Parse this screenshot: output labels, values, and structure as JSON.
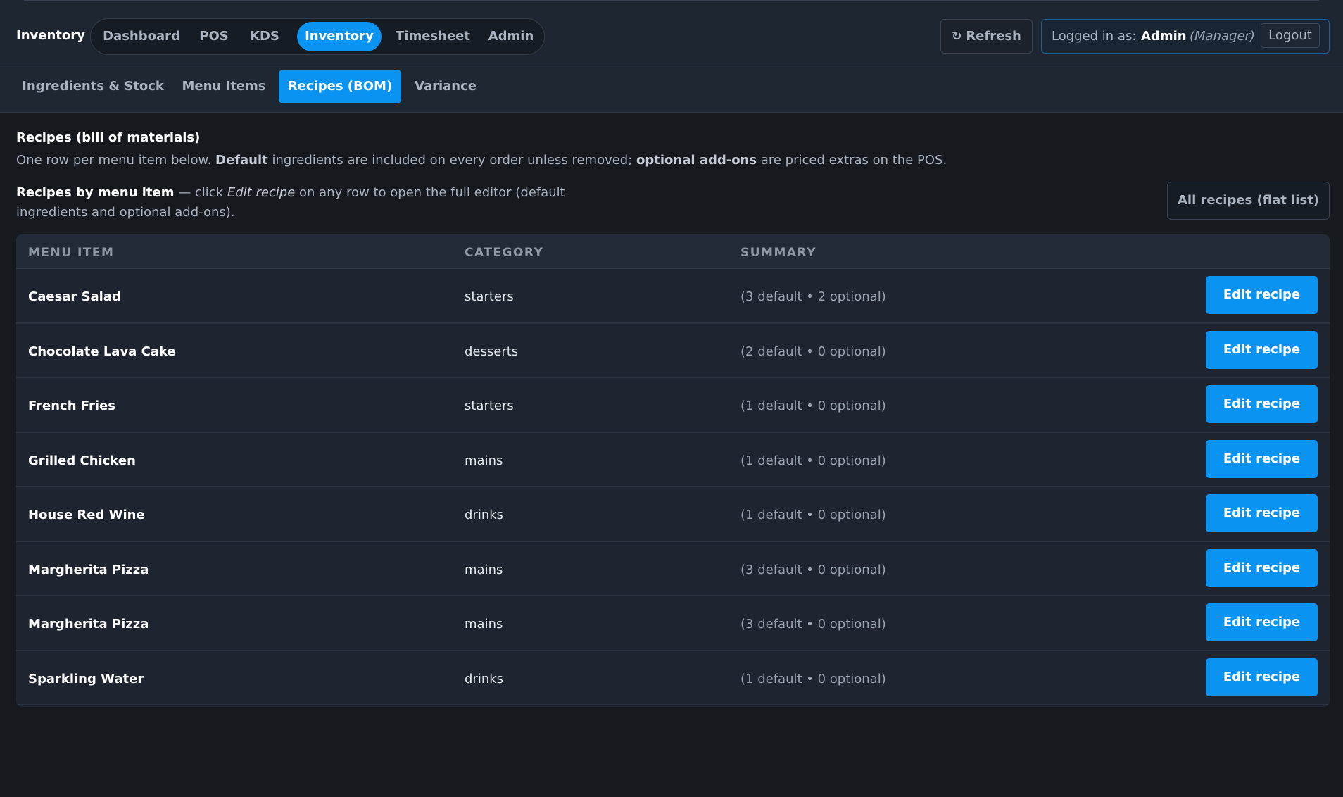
{
  "app": {
    "title": "Inventory"
  },
  "main_nav": {
    "items": [
      {
        "label": "Dashboard",
        "active": false
      },
      {
        "label": "POS",
        "active": false
      },
      {
        "label": "KDS",
        "active": false
      },
      {
        "label": "Inventory",
        "active": true
      },
      {
        "label": "Timesheet",
        "active": false
      },
      {
        "label": "Admin",
        "active": false
      }
    ]
  },
  "toolbar": {
    "refresh_icon": "refresh-icon",
    "refresh_label": "Refresh",
    "logged_in_label": "Logged in as:",
    "user_name": "Admin",
    "user_role": "(Manager)",
    "logout_label": "Logout"
  },
  "sub_nav": {
    "tabs": [
      {
        "label": "Ingredients & Stock",
        "active": false
      },
      {
        "label": "Menu Items",
        "active": false
      },
      {
        "label": "Recipes (BOM)",
        "active": true
      },
      {
        "label": "Variance",
        "active": false
      }
    ]
  },
  "page": {
    "title": "Recipes (bill of materials)",
    "desc_1": "One row per menu item below. ",
    "desc_bold_1": "Default",
    "desc_2": " ingredients are included on every order unless removed; ",
    "desc_bold_2": "optional add-ons",
    "desc_3": " are priced extras on the POS.",
    "hint_bold": "Recipes by menu item",
    "hint_1": " — click ",
    "hint_italic": "Edit recipe",
    "hint_2": " on any row to open the full editor (default ingredients and optional add-ons).",
    "flat_list_label": "All recipes (flat list)"
  },
  "table": {
    "columns": [
      "MENU ITEM",
      "CATEGORY",
      "SUMMARY"
    ],
    "action_label": "Edit recipe",
    "rows": [
      {
        "name": "Caesar Salad",
        "category": "starters",
        "summary": "(3 default • 2 optional)"
      },
      {
        "name": "Chocolate Lava Cake",
        "category": "desserts",
        "summary": "(2 default • 0 optional)"
      },
      {
        "name": "French Fries",
        "category": "starters",
        "summary": "(1 default • 0 optional)"
      },
      {
        "name": "Grilled Chicken",
        "category": "mains",
        "summary": "(1 default • 0 optional)"
      },
      {
        "name": "House Red Wine",
        "category": "drinks",
        "summary": "(1 default • 0 optional)"
      },
      {
        "name": "Margherita Pizza",
        "category": "mains",
        "summary": "(3 default • 0 optional)"
      },
      {
        "name": "Margherita Pizza",
        "category": "mains",
        "summary": "(3 default • 0 optional)"
      },
      {
        "name": "Sparkling Water",
        "category": "drinks",
        "summary": "(1 default • 0 optional)"
      }
    ]
  },
  "colors": {
    "accent": "#0a93f0",
    "background": "#161a1f",
    "panel": "#1e2530"
  }
}
